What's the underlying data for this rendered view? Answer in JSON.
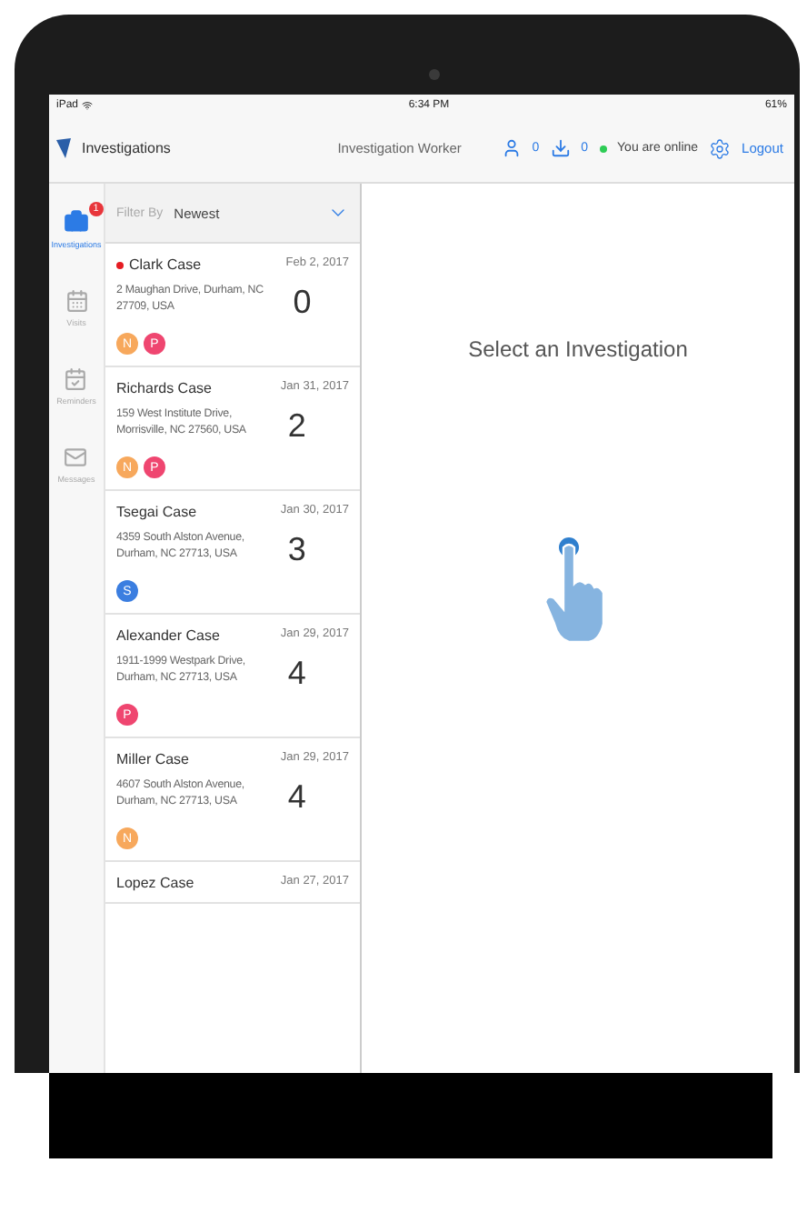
{
  "status_bar": {
    "device": "iPad",
    "time": "6:34 PM",
    "battery": "61%"
  },
  "nav_bar": {
    "app_title": "Investigations",
    "center_title": "Investigation Worker",
    "user_count": "0",
    "download_count": "0",
    "online_status": "You are online",
    "logout": "Logout"
  },
  "sidebar": {
    "items": [
      {
        "kind": "briefcase",
        "label": "Investigations",
        "selected": true,
        "badge": "1"
      },
      {
        "kind": "calendar",
        "label": "Visits",
        "selected": false
      },
      {
        "kind": "reminder",
        "label": "Reminders",
        "selected": false
      },
      {
        "kind": "mail",
        "label": "Messages",
        "selected": false
      }
    ]
  },
  "filter": {
    "label": "Filter By",
    "value": "Newest"
  },
  "cases": [
    {
      "title": "Clark Case",
      "flagged": true,
      "date": "Feb 2, 2017",
      "address": "2 Maughan Drive, Durham, NC 27709, USA",
      "count": "0",
      "avatars": [
        {
          "letter": "N",
          "color": "#f7a85c"
        },
        {
          "letter": "P",
          "color": "#ef4670"
        }
      ]
    },
    {
      "title": "Richards Case",
      "flagged": false,
      "date": "Jan 31, 2017",
      "address": "159 West Institute Drive, Morrisville, NC 27560, USA",
      "count": "2",
      "avatars": [
        {
          "letter": "N",
          "color": "#f7a85c"
        },
        {
          "letter": "P",
          "color": "#ef4670"
        }
      ]
    },
    {
      "title": "Tsegai Case",
      "flagged": false,
      "date": "Jan 30, 2017",
      "address": "4359 South Alston Avenue, Durham, NC 27713, USA",
      "count": "3",
      "avatars": [
        {
          "letter": "S",
          "color": "#3b7ee0"
        }
      ]
    },
    {
      "title": "Alexander Case",
      "flagged": false,
      "date": "Jan 29, 2017",
      "address": "1911-1999 Westpark Drive, Durham, NC 27713, USA",
      "count": "4",
      "avatars": [
        {
          "letter": "P",
          "color": "#ef4670"
        }
      ]
    },
    {
      "title": "Miller Case",
      "flagged": false,
      "date": "Jan 29, 2017",
      "address": "4607 South Alston Avenue, Durham, NC 27713, USA",
      "count": "4",
      "avatars": [
        {
          "letter": "N",
          "color": "#f7a85c"
        }
      ]
    },
    {
      "title": "Lopez Case",
      "flagged": false,
      "date": "Jan 27, 2017"
    }
  ],
  "detail": {
    "prompt": "Select an Investigation"
  }
}
